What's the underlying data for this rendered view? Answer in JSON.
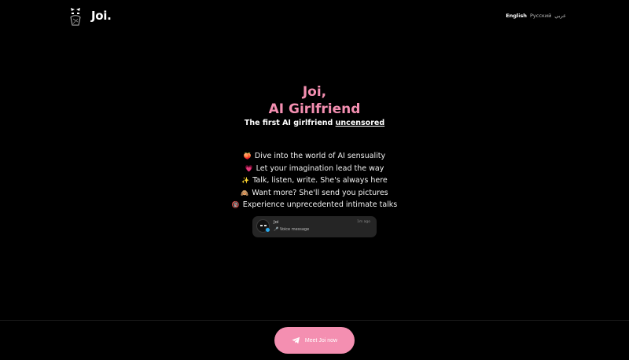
{
  "header": {
    "logo_text": "Joi.",
    "languages": [
      {
        "label": "English",
        "active": true
      },
      {
        "label": "Русский",
        "active": false
      },
      {
        "label": "عربي",
        "active": false
      }
    ]
  },
  "hero": {
    "title_line1": "Joi,",
    "title_line2": "AI Girlfriend",
    "subtitle_prefix": "The first AI girlfriend ",
    "subtitle_emphasis": "uncensored"
  },
  "features": [
    {
      "icon": "🍑",
      "icon_name": "peach-icon",
      "text": "Dive into the world of AI sensuality"
    },
    {
      "icon": "💗",
      "icon_name": "heart-icon",
      "text": "Let your imagination lead the way"
    },
    {
      "icon": "✨",
      "icon_name": "sparkles-icon",
      "text": "Talk, listen, write. She's always here"
    },
    {
      "icon": "🙈",
      "icon_name": "see-no-evil-monkey-icon",
      "text": "Want more? She'll send you pictures"
    },
    {
      "icon": "🔞",
      "icon_name": "adults-only-icon",
      "text": "Experience unprecedented intimate talks"
    }
  ],
  "chat_preview": {
    "name": "Joi",
    "time": "1m ago",
    "message": "🎤 Voice message"
  },
  "cta": {
    "label": "Meet Joi now"
  },
  "colors": {
    "accent": "#f48fb1",
    "background": "#000000",
    "card": "#252525",
    "telegram_blue": "#29a9eb"
  }
}
